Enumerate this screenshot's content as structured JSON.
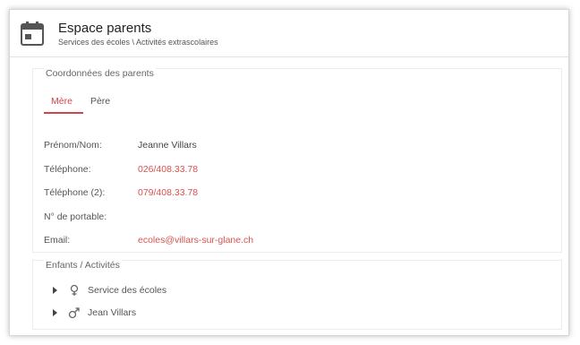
{
  "header": {
    "title": "Espace parents",
    "breadcrumb": "Services des écoles \\ Activités extrascolaires",
    "icon": "calendar-icon"
  },
  "parents": {
    "legend": "Coordonnées des parents",
    "tabs": [
      {
        "label": "Mère",
        "active": true
      },
      {
        "label": "Père",
        "active": false
      }
    ],
    "fields": [
      {
        "label": "Prénom/Nom:",
        "value": "Jeanne Villars"
      },
      {
        "label": "Téléphone:",
        "value": "026/408.33.78"
      },
      {
        "label": "Téléphone (2):",
        "value": "079/408.33.78"
      },
      {
        "label": "N° de portable:",
        "value": ""
      },
      {
        "label": "Email:",
        "value": "ecoles@villars-sur-glane.ch"
      }
    ]
  },
  "children": {
    "legend": "Enfants / Activités",
    "items": [
      {
        "label": "Service des écoles",
        "icon": "female-icon"
      },
      {
        "label": "Jean Villars",
        "icon": "male-icon"
      }
    ]
  },
  "colors": {
    "accent": "#d0454c",
    "link": "#d9534f"
  }
}
